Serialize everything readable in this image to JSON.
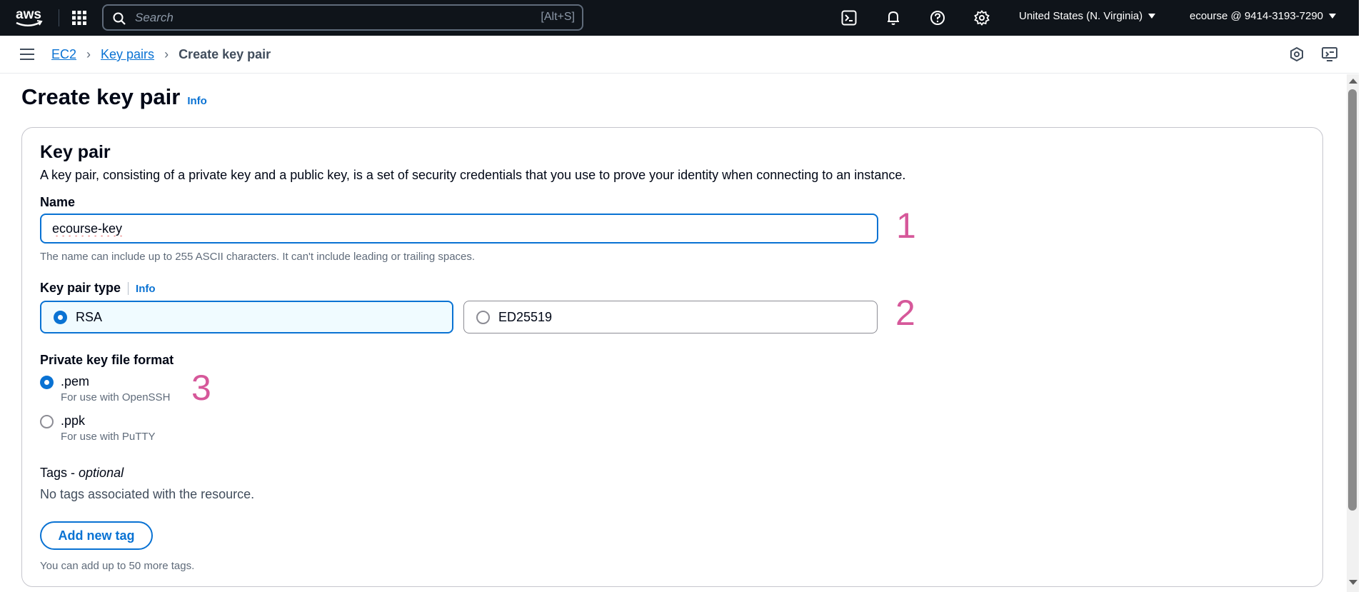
{
  "topnav": {
    "logo_text": "aws",
    "search_placeholder": "Search",
    "search_shortcut": "[Alt+S]",
    "region": "United States (N. Virginia)",
    "account": "ecourse @ 9414-3193-7290",
    "icons": [
      "apps-grid-icon",
      "cloudshell-icon",
      "bell-icon",
      "help-icon",
      "settings-icon"
    ]
  },
  "breadcrumb": {
    "items": [
      "EC2",
      "Key pairs"
    ],
    "current": "Create key pair"
  },
  "page": {
    "title": "Create key pair",
    "info": "Info"
  },
  "key_pair": {
    "title": "Key pair",
    "description": "A key pair, consisting of a private key and a public key, is a set of security credentials that you use to prove your identity when connecting to an instance.",
    "name_label": "Name",
    "name_value": "ecourse-key",
    "name_hint": "The name can include up to 255 ASCII characters. It can't include leading or trailing spaces.",
    "type_label": "Key pair type",
    "type_info": "Info",
    "types": [
      {
        "label": "RSA",
        "selected": true
      },
      {
        "label": "ED25519",
        "selected": false
      }
    ],
    "format_label": "Private key file format",
    "formats": [
      {
        "label": ".pem",
        "sub": "For use with OpenSSH",
        "selected": true
      },
      {
        "label": ".ppk",
        "sub": "For use with PuTTY",
        "selected": false
      }
    ],
    "tags_label": "Tags - ",
    "tags_optional": "optional",
    "tags_empty": "No tags associated with the resource.",
    "add_tag": "Add new tag",
    "tags_hint": "You can add up to 50 more tags."
  },
  "annotations": [
    "1",
    "2",
    "3"
  ],
  "colors": {
    "nav_bg": "#0f141a",
    "link": "#0972d3",
    "annotation": "#d6589a"
  }
}
